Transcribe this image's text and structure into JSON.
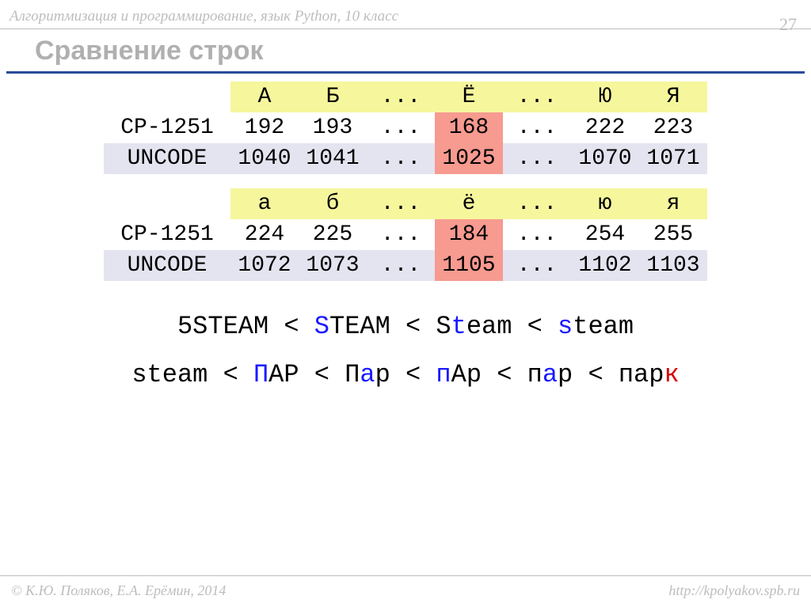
{
  "header": {
    "course": "Алгоритмизация и программирование, язык Python, 10 класс",
    "page": "27"
  },
  "title": "Сравнение строк",
  "tables": [
    {
      "header": [
        "А",
        "Б",
        "...",
        "Ё",
        "...",
        "Ю",
        "Я"
      ],
      "rows": [
        {
          "label": "CP-1251",
          "cells": [
            "192",
            "193",
            "...",
            "168",
            "...",
            "222",
            "223"
          ],
          "alt": false,
          "hlIndex": 3
        },
        {
          "label": "UNCODE",
          "cells": [
            "1040",
            "1041",
            "...",
            "1025",
            "...",
            "1070",
            "1071"
          ],
          "alt": true,
          "hlIndex": 3
        }
      ]
    },
    {
      "header": [
        "а",
        "б",
        "...",
        "ё",
        "...",
        "ю",
        "я"
      ],
      "rows": [
        {
          "label": "CP-1251",
          "cells": [
            "224",
            "225",
            "...",
            "184",
            "...",
            "254",
            "255"
          ],
          "alt": false,
          "hlIndex": 3
        },
        {
          "label": "UNCODE",
          "cells": [
            "1072",
            "1073",
            "...",
            "1105",
            "...",
            "1102",
            "1103"
          ],
          "alt": true,
          "hlIndex": 3
        }
      ]
    }
  ],
  "examples": {
    "line1": [
      {
        "t": "5STEAM < ",
        "c": ""
      },
      {
        "t": "S",
        "c": "blue"
      },
      {
        "t": "TEAM < S",
        "c": ""
      },
      {
        "t": "t",
        "c": "blue"
      },
      {
        "t": "eam < ",
        "c": ""
      },
      {
        "t": "s",
        "c": "blue"
      },
      {
        "t": "team",
        "c": ""
      }
    ],
    "line2": [
      {
        "t": "steam < ",
        "c": ""
      },
      {
        "t": "П",
        "c": "blue"
      },
      {
        "t": "АР < П",
        "c": ""
      },
      {
        "t": "а",
        "c": "blue"
      },
      {
        "t": "р < ",
        "c": ""
      },
      {
        "t": "п",
        "c": "blue"
      },
      {
        "t": "Ар < п",
        "c": ""
      },
      {
        "t": "а",
        "c": "blue"
      },
      {
        "t": "р < пар",
        "c": ""
      },
      {
        "t": "к",
        "c": "red"
      }
    ]
  },
  "footer": {
    "left": "© К.Ю. Поляков, Е.А. Ерёмин, 2014",
    "right": "http://kpolyakov.spb.ru"
  }
}
